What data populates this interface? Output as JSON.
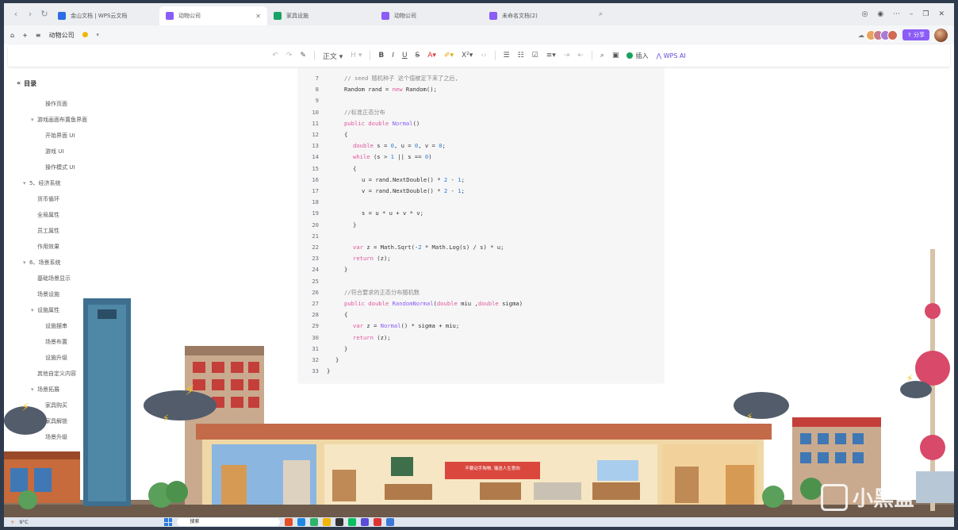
{
  "tabs": [
    {
      "label": "金山文档 | WPS云文档",
      "color": "#2a6de5",
      "active": false
    },
    {
      "label": "动物公司",
      "color": "#8b5cf6",
      "active": true
    },
    {
      "label": "家具设施",
      "color": "#1aa364",
      "active": false
    },
    {
      "label": "动物公司",
      "color": "#8b5cf6",
      "active": false
    },
    {
      "label": "未命名文档(2)",
      "color": "#8b5cf6",
      "active": false
    }
  ],
  "docbar": {
    "doc_title": "动物公司",
    "share_label": "分享"
  },
  "toolbar": {
    "style_label": "正文",
    "insert_label": "插入",
    "ai_label": "WPS AI"
  },
  "outline": {
    "title": "目录",
    "items": [
      {
        "label": "操作页面",
        "indent": 2,
        "bullet": false
      },
      {
        "label": "游戏画面布置鱼界面",
        "indent": 1,
        "bullet": true
      },
      {
        "label": "开始界面 UI",
        "indent": 2,
        "bullet": false
      },
      {
        "label": "游戏 UI",
        "indent": 2,
        "bullet": false
      },
      {
        "label": "操作模式 UI",
        "indent": 2,
        "bullet": false
      },
      {
        "label": "5、经济系统",
        "indent": 0,
        "bullet": true
      },
      {
        "label": "货币循环",
        "indent": 1,
        "bullet": false
      },
      {
        "label": "全局属性",
        "indent": 1,
        "bullet": false
      },
      {
        "label": "员工属性",
        "indent": 1,
        "bullet": false
      },
      {
        "label": "作用效果",
        "indent": 1,
        "bullet": false
      },
      {
        "label": "6、场景系统",
        "indent": 0,
        "bullet": true
      },
      {
        "label": "基础场景显示",
        "indent": 1,
        "bullet": false
      },
      {
        "label": "场景设施",
        "indent": 1,
        "bullet": false
      },
      {
        "label": "设施属性",
        "indent": 1,
        "bullet": true
      },
      {
        "label": "设施摆串",
        "indent": 2,
        "bullet": false
      },
      {
        "label": "场景布置",
        "indent": 2,
        "bullet": false
      },
      {
        "label": "设施升级",
        "indent": 2,
        "bullet": false
      },
      {
        "label": "其他自定义内容",
        "indent": 1,
        "bullet": false
      },
      {
        "label": "场景拓展",
        "indent": 1,
        "bullet": true
      },
      {
        "label": "家具购买",
        "indent": 2,
        "bullet": false
      },
      {
        "label": "家具解锁",
        "indent": 2,
        "bullet": false
      },
      {
        "label": "场景升级",
        "indent": 2,
        "bullet": false
      }
    ]
  },
  "code": {
    "lines": [
      {
        "n": "7",
        "indent": 2,
        "text": "// seed 随机种子 这个值被定下来了之后,"
      },
      {
        "n": "8",
        "indent": 2,
        "text": "Random rand = new Random();"
      },
      {
        "n": "9",
        "indent": 0,
        "text": ""
      },
      {
        "n": "10",
        "indent": 2,
        "text": "//标准正态分布"
      },
      {
        "n": "11",
        "indent": 2,
        "text": "public double Normal()"
      },
      {
        "n": "12",
        "indent": 2,
        "text": "{"
      },
      {
        "n": "13",
        "indent": 3,
        "text": "double s = 0, u = 0, v = 0;"
      },
      {
        "n": "14",
        "indent": 3,
        "text": "while (s > 1 || s == 0)"
      },
      {
        "n": "15",
        "indent": 3,
        "text": "{"
      },
      {
        "n": "16",
        "indent": 4,
        "text": "u = rand.NextDouble() * 2 - 1;"
      },
      {
        "n": "17",
        "indent": 4,
        "text": "v = rand.NextDouble() * 2 - 1;"
      },
      {
        "n": "18",
        "indent": 0,
        "text": ""
      },
      {
        "n": "19",
        "indent": 4,
        "text": "s = u * u + v * v;"
      },
      {
        "n": "20",
        "indent": 3,
        "text": "}"
      },
      {
        "n": "21",
        "indent": 0,
        "text": ""
      },
      {
        "n": "22",
        "indent": 3,
        "text": "var z = Math.Sqrt(-2 * Math.Log(s) / s) * u;"
      },
      {
        "n": "23",
        "indent": 3,
        "text": "return (z);"
      },
      {
        "n": "24",
        "indent": 2,
        "text": "}"
      },
      {
        "n": "25",
        "indent": 0,
        "text": ""
      },
      {
        "n": "26",
        "indent": 2,
        "text": "//符合要求的正态分布随机数"
      },
      {
        "n": "27",
        "indent": 2,
        "text": "public double RandomNormal(double miu ,double sigma)"
      },
      {
        "n": "28",
        "indent": 2,
        "text": "{"
      },
      {
        "n": "29",
        "indent": 3,
        "text": "var z = Normal() * sigma + miu;"
      },
      {
        "n": "30",
        "indent": 3,
        "text": "return (z);"
      },
      {
        "n": "31",
        "indent": 2,
        "text": "}"
      },
      {
        "n": "32",
        "indent": 1,
        "text": "}"
      },
      {
        "n": "33",
        "indent": 0,
        "text": "}"
      }
    ]
  },
  "banner": {
    "text": "不要动手掏物, 输送人生意向"
  },
  "taskbar": {
    "weather": "9°C",
    "search_placeholder": "搜索"
  },
  "watermark": {
    "text": "小黑盒"
  },
  "colors": {
    "accent": "#8b5cf6",
    "keyword": "#e0569a",
    "number": "#2a7ae2",
    "comment": "#8a8a8a"
  }
}
